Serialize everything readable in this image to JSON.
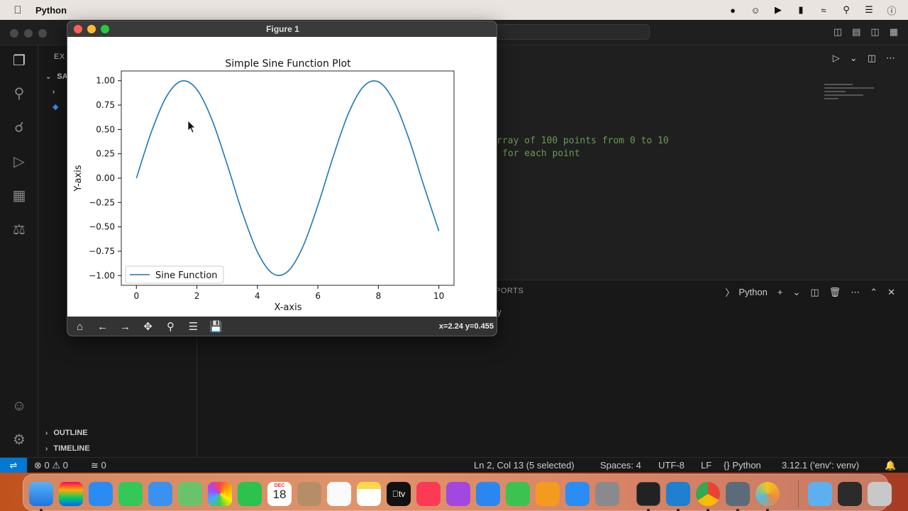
{
  "menubar": {
    "app_name": "Python"
  },
  "vscode": {
    "sidebar": {
      "header": "EX",
      "section_label": "SA",
      "outline": "OUTLINE",
      "timeline": "TIMELINE"
    },
    "editor": {
      "code_lines": [
        "rray of 100 points from 0 to 10",
        "for each point"
      ]
    },
    "panel": {
      "tab_label": "PORTS",
      "terminal_name": "Python",
      "terminal_text": "y"
    },
    "statusbar": {
      "errors": "0",
      "warnings": "0",
      "ports": "0",
      "cursor": "Ln 2, Col 13 (5 selected)",
      "spaces": "Spaces: 4",
      "encoding": "UTF-8",
      "eol": "LF",
      "language": "Python",
      "interpreter": "3.12.1 ('env': venv)"
    }
  },
  "dock": {
    "calendar_month": "DEC",
    "calendar_day": "18",
    "appletv_label": "tv"
  },
  "figure": {
    "window_title": "Figure 1",
    "coords": "x=2.24 y=0.455"
  },
  "chart_data": {
    "type": "line",
    "title": "Simple Sine Function Plot",
    "xlabel": "X-axis",
    "ylabel": "Y-axis",
    "xlim": [
      -0.5,
      10.5
    ],
    "ylim": [
      -1.1,
      1.1
    ],
    "xticks": [
      0,
      2,
      4,
      6,
      8,
      10
    ],
    "yticks": [
      -1.0,
      -0.75,
      -0.5,
      -0.25,
      0.0,
      0.25,
      0.5,
      0.75,
      1.0
    ],
    "ytick_labels": [
      "−1.00",
      "−0.75",
      "−0.50",
      "−0.25",
      "0.00",
      "0.25",
      "0.50",
      "0.75",
      "1.00"
    ],
    "xtick_labels": [
      "0",
      "2",
      "4",
      "6",
      "8",
      "10"
    ],
    "legend_placement": "lower-left",
    "grid": false,
    "series": [
      {
        "name": "Sine Function",
        "color": "#1f77b4",
        "x": [
          0,
          0.5,
          1,
          1.5,
          2,
          2.5,
          3,
          3.5,
          4,
          4.5,
          5,
          5.5,
          6,
          6.5,
          7,
          7.5,
          8,
          8.5,
          9,
          9.5,
          10
        ],
        "y": [
          0,
          0.479,
          0.841,
          0.997,
          0.909,
          0.598,
          0.141,
          -0.351,
          -0.757,
          -0.978,
          -0.959,
          -0.706,
          -0.279,
          0.215,
          0.657,
          0.938,
          0.989,
          0.798,
          0.412,
          -0.075,
          -0.544
        ]
      }
    ]
  }
}
